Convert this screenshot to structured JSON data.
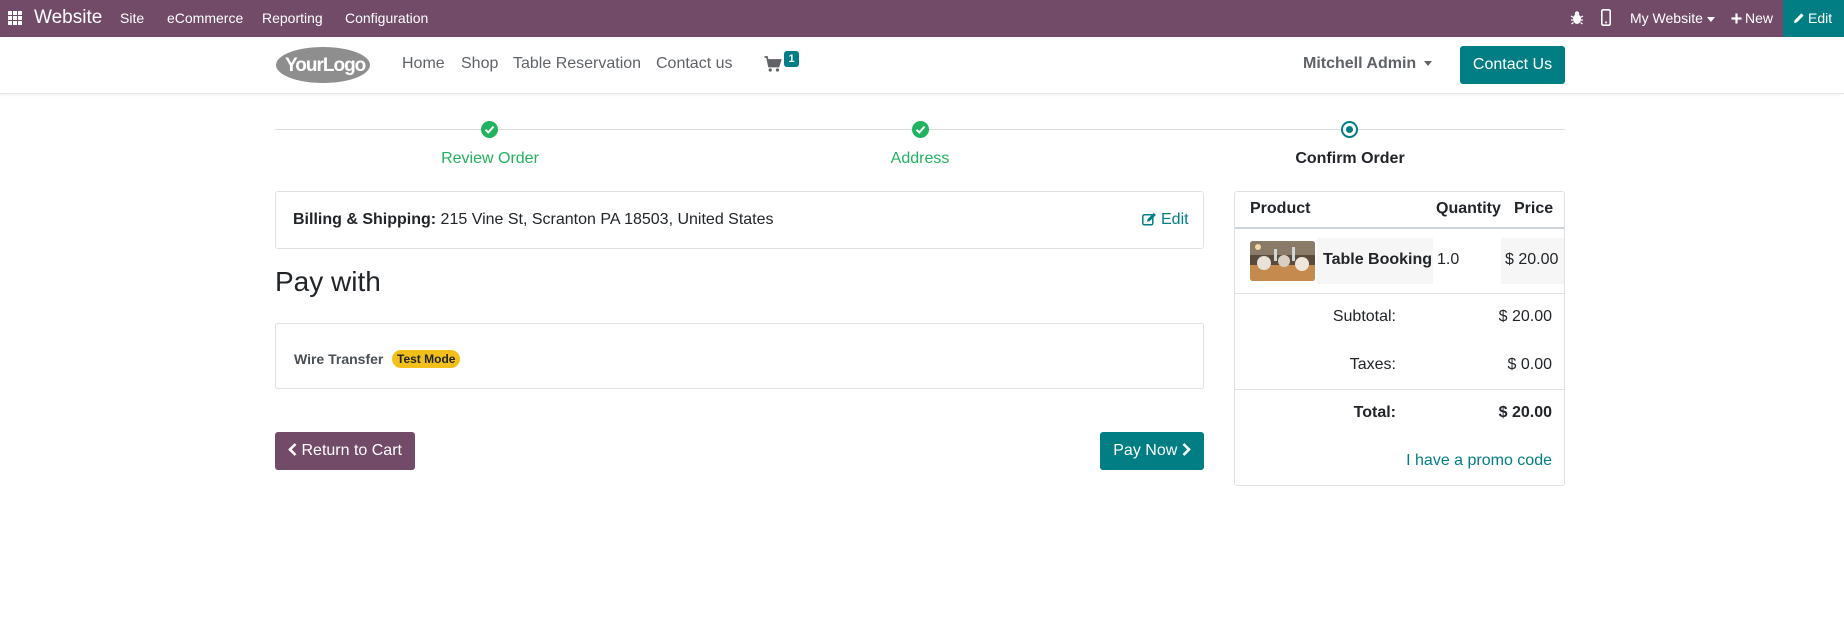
{
  "topbar": {
    "brand": "Website",
    "menu": [
      "Site",
      "eCommerce",
      "Reporting",
      "Configuration"
    ],
    "my_website": "My Website",
    "new_label": "New",
    "edit_label": "Edit"
  },
  "header": {
    "logo_text": "YourLogo",
    "nav": [
      "Home",
      "Shop",
      "Table Reservation",
      "Contact us"
    ],
    "cart_count": "1",
    "user": "Mitchell Admin",
    "contact_button": "Contact Us"
  },
  "wizard": {
    "steps": [
      {
        "label": "Review Order",
        "state": "done"
      },
      {
        "label": "Address",
        "state": "done"
      },
      {
        "label": "Confirm Order",
        "state": "current"
      }
    ]
  },
  "billing": {
    "label": "Billing & Shipping:",
    "address": "215 Vine St, Scranton PA 18503, United States",
    "edit_label": "Edit"
  },
  "payment": {
    "heading": "Pay with",
    "method": "Wire Transfer",
    "badge": "Test Mode"
  },
  "actions": {
    "return_label": "Return to Cart",
    "pay_label": "Pay Now"
  },
  "summary": {
    "headers": {
      "product": "Product",
      "quantity": "Quantity",
      "price": "Price"
    },
    "line": {
      "name": "Table Booking",
      "quantity": "1.0",
      "price": "$ 20.00"
    },
    "subtotal_label": "Subtotal:",
    "subtotal": "$ 20.00",
    "taxes_label": "Taxes:",
    "taxes": "$ 0.00",
    "total_label": "Total:",
    "total": "$ 20.00",
    "promo_label": "I have a promo code"
  },
  "colors": {
    "admin_bar": "#714B67",
    "primary": "#017E84",
    "success": "#21B35F",
    "warning": "#F3C01B"
  }
}
